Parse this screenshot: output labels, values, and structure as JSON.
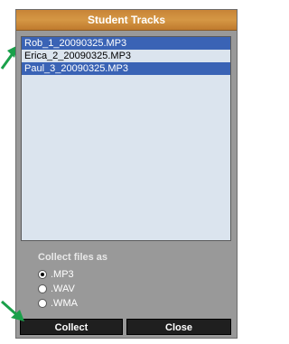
{
  "dialog": {
    "title": "Student Tracks"
  },
  "tracks": [
    {
      "name": "Rob_1_20090325.MP3",
      "selected": true
    },
    {
      "name": "Erica_2_20090325.MP3",
      "selected": false
    },
    {
      "name": "Paul_3_20090325.MP3",
      "selected": true
    }
  ],
  "collect": {
    "label": "Collect files as",
    "options": [
      {
        "label": ".MP3",
        "checked": true
      },
      {
        "label": ".WAV",
        "checked": false
      },
      {
        "label": ".WMA",
        "checked": false
      }
    ]
  },
  "buttons": {
    "collect_label": "Collect",
    "close_label": "Close"
  },
  "colors": {
    "title_bar": "#d08a3a",
    "selection": "#3a63b5",
    "arrow": "#1aa04a"
  },
  "icons": {
    "arrow_top": "green-arrow-icon",
    "arrow_bottom": "green-arrow-icon"
  }
}
